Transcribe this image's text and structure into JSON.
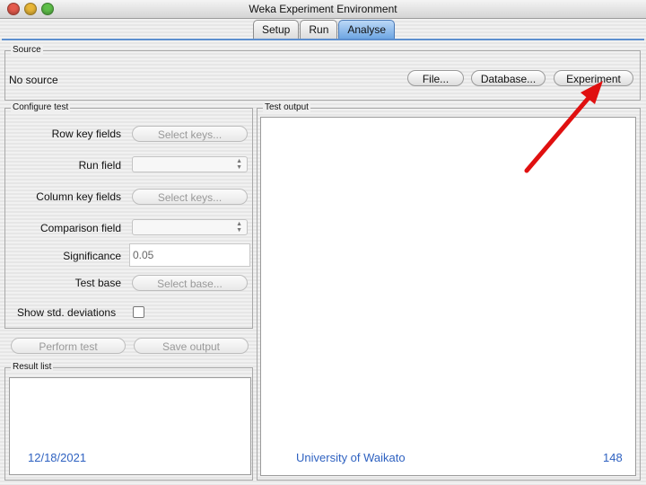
{
  "window": {
    "title": "Weka Experiment Environment"
  },
  "tabs": [
    {
      "label": "Setup",
      "active": false
    },
    {
      "label": "Run",
      "active": false
    },
    {
      "label": "Analyse",
      "active": true
    }
  ],
  "source": {
    "legend": "Source",
    "status": "No source",
    "file_button": "File...",
    "database_button": "Database...",
    "experiment_button": "Experiment"
  },
  "configure": {
    "legend": "Configure test",
    "row_key_label": "Row key fields",
    "row_key_button": "Select keys...",
    "run_field_label": "Run field",
    "column_key_label": "Column key fields",
    "column_key_button": "Select keys...",
    "comparison_field_label": "Comparison field",
    "significance_label": "Significance",
    "significance_value": "0.05",
    "test_base_label": "Test base",
    "test_base_button": "Select base...",
    "show_std_label": "Show std. deviations",
    "show_std_checked": false
  },
  "actions": {
    "perform_test": "Perform test",
    "save_output": "Save output"
  },
  "result_list": {
    "legend": "Result list"
  },
  "test_output": {
    "legend": "Test output"
  },
  "footer": {
    "date": "12/18/2021",
    "org": "University of Waikato",
    "page": "148"
  },
  "colors": {
    "arrow": "#e01010",
    "accent": "#5d8fcf",
    "footer_text": "#2f62c1"
  }
}
